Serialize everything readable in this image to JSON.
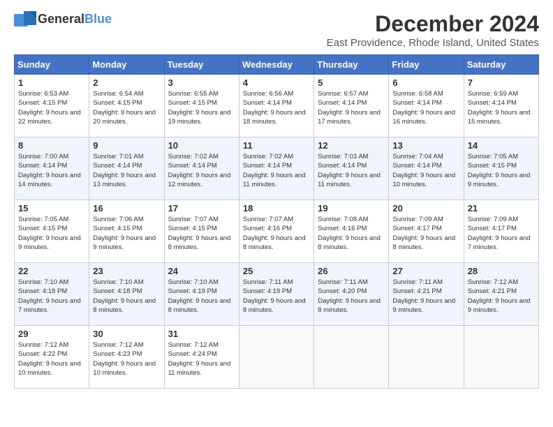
{
  "logo": {
    "line1": "General",
    "line2": "Blue"
  },
  "title": "December 2024",
  "subtitle": "East Providence, Rhode Island, United States",
  "days_of_week": [
    "Sunday",
    "Monday",
    "Tuesday",
    "Wednesday",
    "Thursday",
    "Friday",
    "Saturday"
  ],
  "weeks": [
    [
      {
        "day": "1",
        "sunrise": "6:53 AM",
        "sunset": "4:15 PM",
        "daylight": "9 hours and 22 minutes."
      },
      {
        "day": "2",
        "sunrise": "6:54 AM",
        "sunset": "4:15 PM",
        "daylight": "9 hours and 20 minutes."
      },
      {
        "day": "3",
        "sunrise": "6:55 AM",
        "sunset": "4:15 PM",
        "daylight": "9 hours and 19 minutes."
      },
      {
        "day": "4",
        "sunrise": "6:56 AM",
        "sunset": "4:14 PM",
        "daylight": "9 hours and 18 minutes."
      },
      {
        "day": "5",
        "sunrise": "6:57 AM",
        "sunset": "4:14 PM",
        "daylight": "9 hours and 17 minutes."
      },
      {
        "day": "6",
        "sunrise": "6:58 AM",
        "sunset": "4:14 PM",
        "daylight": "9 hours and 16 minutes."
      },
      {
        "day": "7",
        "sunrise": "6:59 AM",
        "sunset": "4:14 PM",
        "daylight": "9 hours and 15 minutes."
      }
    ],
    [
      {
        "day": "8",
        "sunrise": "7:00 AM",
        "sunset": "4:14 PM",
        "daylight": "9 hours and 14 minutes."
      },
      {
        "day": "9",
        "sunrise": "7:01 AM",
        "sunset": "4:14 PM",
        "daylight": "9 hours and 13 minutes."
      },
      {
        "day": "10",
        "sunrise": "7:02 AM",
        "sunset": "4:14 PM",
        "daylight": "9 hours and 12 minutes."
      },
      {
        "day": "11",
        "sunrise": "7:02 AM",
        "sunset": "4:14 PM",
        "daylight": "9 hours and 11 minutes."
      },
      {
        "day": "12",
        "sunrise": "7:03 AM",
        "sunset": "4:14 PM",
        "daylight": "9 hours and 11 minutes."
      },
      {
        "day": "13",
        "sunrise": "7:04 AM",
        "sunset": "4:14 PM",
        "daylight": "9 hours and 10 minutes."
      },
      {
        "day": "14",
        "sunrise": "7:05 AM",
        "sunset": "4:15 PM",
        "daylight": "9 hours and 9 minutes."
      }
    ],
    [
      {
        "day": "15",
        "sunrise": "7:05 AM",
        "sunset": "4:15 PM",
        "daylight": "9 hours and 9 minutes."
      },
      {
        "day": "16",
        "sunrise": "7:06 AM",
        "sunset": "4:15 PM",
        "daylight": "9 hours and 9 minutes."
      },
      {
        "day": "17",
        "sunrise": "7:07 AM",
        "sunset": "4:15 PM",
        "daylight": "9 hours and 8 minutes."
      },
      {
        "day": "18",
        "sunrise": "7:07 AM",
        "sunset": "4:16 PM",
        "daylight": "9 hours and 8 minutes."
      },
      {
        "day": "19",
        "sunrise": "7:08 AM",
        "sunset": "4:16 PM",
        "daylight": "9 hours and 8 minutes."
      },
      {
        "day": "20",
        "sunrise": "7:09 AM",
        "sunset": "4:17 PM",
        "daylight": "9 hours and 8 minutes."
      },
      {
        "day": "21",
        "sunrise": "7:09 AM",
        "sunset": "4:17 PM",
        "daylight": "9 hours and 7 minutes."
      }
    ],
    [
      {
        "day": "22",
        "sunrise": "7:10 AM",
        "sunset": "4:18 PM",
        "daylight": "9 hours and 7 minutes."
      },
      {
        "day": "23",
        "sunrise": "7:10 AM",
        "sunset": "4:18 PM",
        "daylight": "9 hours and 8 minutes."
      },
      {
        "day": "24",
        "sunrise": "7:10 AM",
        "sunset": "4:19 PM",
        "daylight": "9 hours and 8 minutes."
      },
      {
        "day": "25",
        "sunrise": "7:11 AM",
        "sunset": "4:19 PM",
        "daylight": "9 hours and 8 minutes."
      },
      {
        "day": "26",
        "sunrise": "7:11 AM",
        "sunset": "4:20 PM",
        "daylight": "9 hours and 8 minutes."
      },
      {
        "day": "27",
        "sunrise": "7:11 AM",
        "sunset": "4:21 PM",
        "daylight": "9 hours and 9 minutes."
      },
      {
        "day": "28",
        "sunrise": "7:12 AM",
        "sunset": "4:21 PM",
        "daylight": "9 hours and 9 minutes."
      }
    ],
    [
      {
        "day": "29",
        "sunrise": "7:12 AM",
        "sunset": "4:22 PM",
        "daylight": "9 hours and 10 minutes."
      },
      {
        "day": "30",
        "sunrise": "7:12 AM",
        "sunset": "4:23 PM",
        "daylight": "9 hours and 10 minutes."
      },
      {
        "day": "31",
        "sunrise": "7:12 AM",
        "sunset": "4:24 PM",
        "daylight": "9 hours and 11 minutes."
      },
      null,
      null,
      null,
      null
    ]
  ],
  "labels": {
    "sunrise": "Sunrise:",
    "sunset": "Sunset:",
    "daylight": "Daylight:"
  }
}
